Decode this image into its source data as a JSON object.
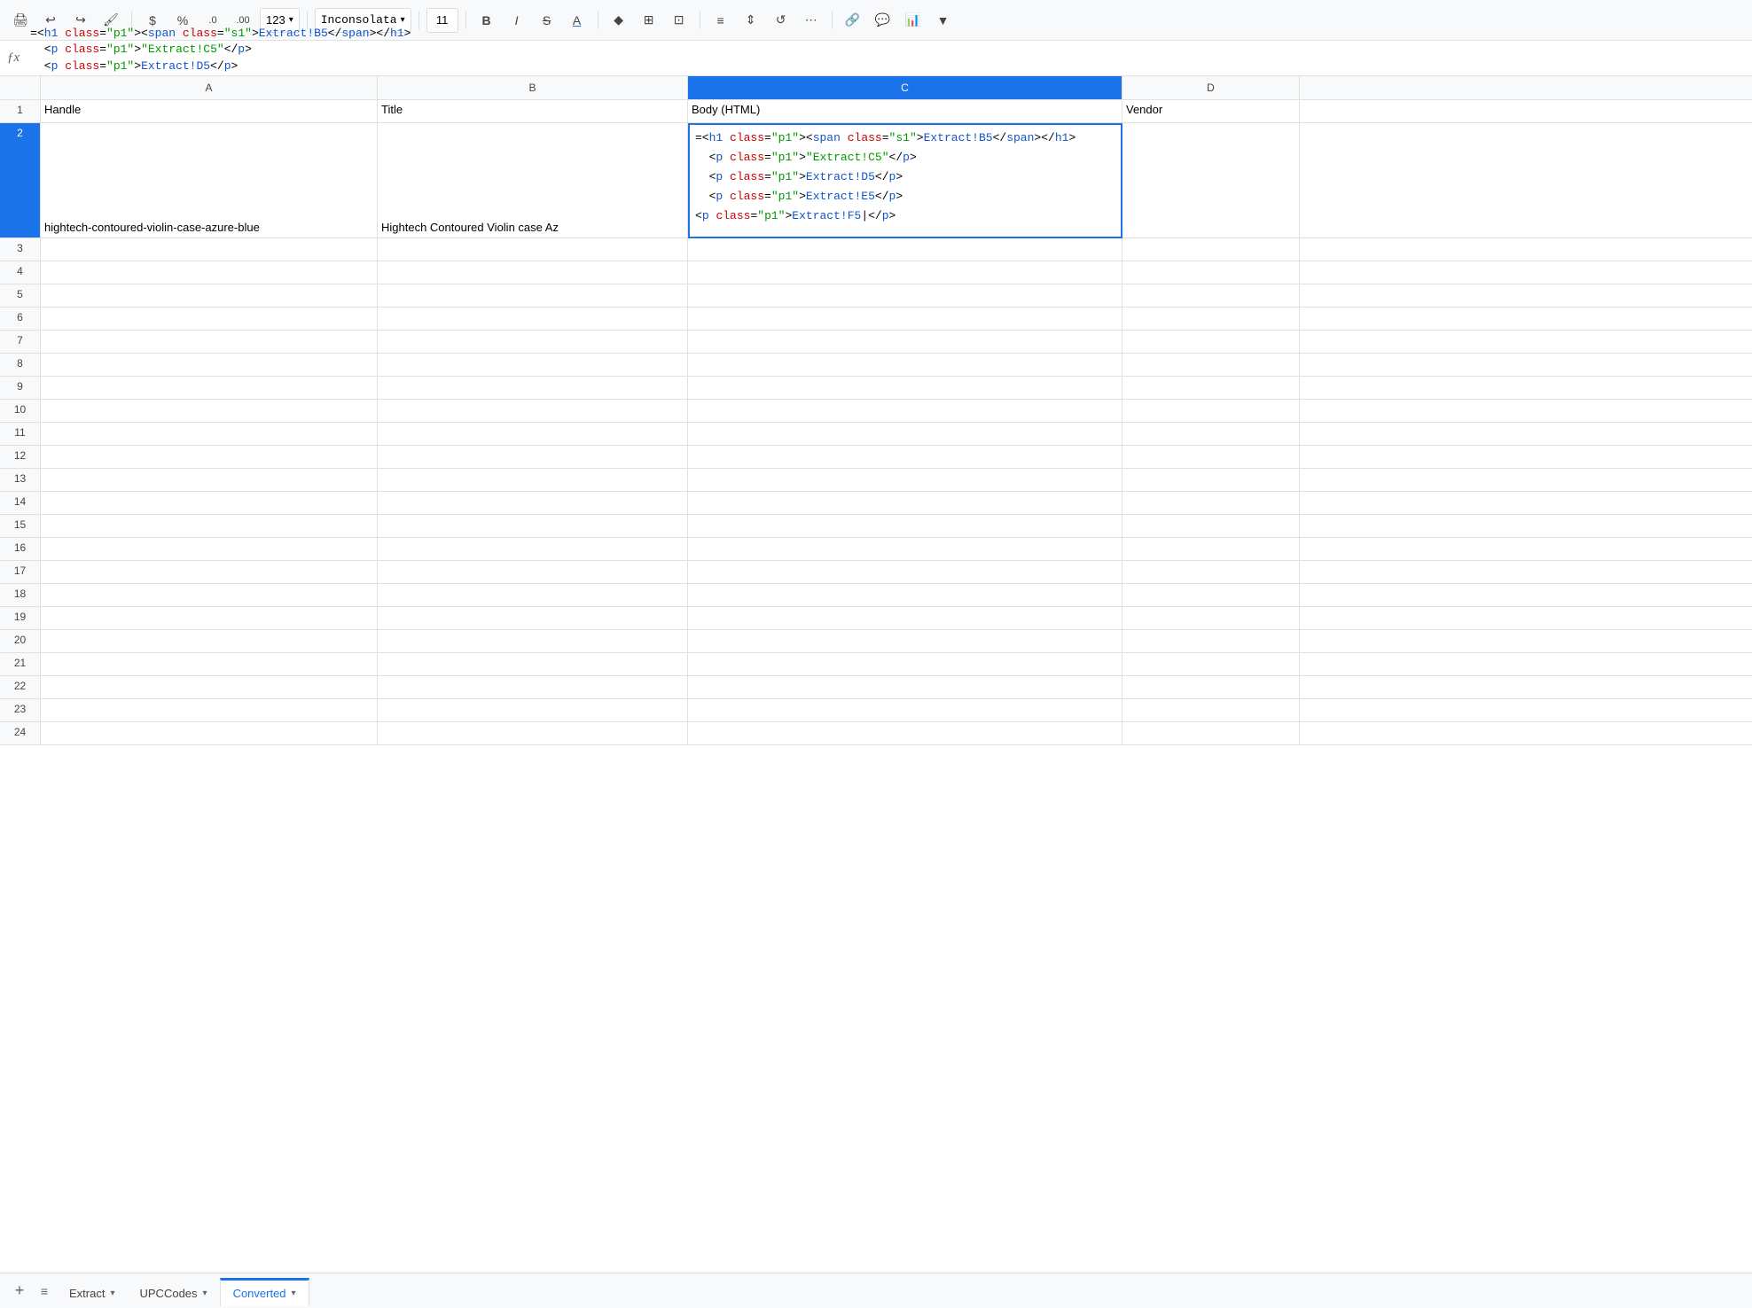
{
  "toolbar": {
    "print_label": "🖨",
    "undo_label": "↩",
    "redo_label": "↪",
    "paint_label": "🖌",
    "currency_label": "$",
    "percent_label": "%",
    "decimal_dec_label": ".0",
    "decimal_inc_label": ".00",
    "more_formats_label": "123",
    "font_name": "Inconsolata",
    "font_size": "11",
    "bold_label": "B",
    "italic_label": "I",
    "strikethrough_label": "S",
    "underline_label": "A",
    "text_color_label": "A",
    "fill_color_label": "◆",
    "borders_label": "⊞",
    "merge_label": "⊡",
    "halign_label": "≡",
    "valign_label": "⇕",
    "rotate_label": "↺",
    "more_label": "⋯",
    "link_label": "🔗",
    "comment_label": "💬",
    "chart_label": "📊",
    "filter_label": "▼"
  },
  "formula_bar": {
    "icon": "ƒx",
    "lines": [
      "=<h1 class=\"p1\"><span class=\"s1\">Extract!B5</span></h1>",
      "  <p class=\"p1\">\"Extract!C5\"</p>",
      "  <p class=\"p1\">Extract!D5</p>",
      "  <p class=\"p1\">Extract!E5</p>"
    ]
  },
  "columns": {
    "headers": [
      "A",
      "B",
      "C",
      "D"
    ],
    "labels": [
      "Handle",
      "Title",
      "Body (HTML)",
      "Vendor"
    ]
  },
  "rows": {
    "count": 24,
    "data": [
      {
        "num": 1,
        "a": "Handle",
        "b": "Title",
        "c": "Body (HTML)",
        "d": "Vendor"
      },
      {
        "num": 2,
        "a": "hightech-contoured-violin-case-azure-blue",
        "b": "Hightech Contoured Violin case Az",
        "c": "FORMULA_CELL",
        "d": ""
      },
      {
        "num": 3,
        "a": "",
        "b": "",
        "c": "",
        "d": ""
      },
      {
        "num": 4,
        "a": "",
        "b": "",
        "c": "",
        "d": ""
      },
      {
        "num": 5,
        "a": "",
        "b": "",
        "c": "",
        "d": ""
      }
    ]
  },
  "cell_overlay": {
    "lines": [
      {
        "type": "mixed",
        "parts": [
          {
            "text": "=<",
            "color": "plain"
          },
          {
            "text": "h1",
            "color": "tag"
          },
          {
            "text": " ",
            "color": "plain"
          },
          {
            "text": "class",
            "color": "attr"
          },
          {
            "text": "=",
            "color": "plain"
          },
          {
            "text": "\"p1\"",
            "color": "val"
          },
          {
            "text": "><",
            "color": "plain"
          },
          {
            "text": "span",
            "color": "tag"
          },
          {
            "text": " ",
            "color": "plain"
          },
          {
            "text": "class",
            "color": "attr"
          },
          {
            "text": "=",
            "color": "plain"
          },
          {
            "text": "\"s1\"",
            "color": "val"
          },
          {
            "text": ">",
            "color": "plain"
          },
          {
            "text": "Extract!B5",
            "color": "ref"
          },
          {
            "text": "</",
            "color": "plain"
          },
          {
            "text": "span",
            "color": "tag"
          },
          {
            "text": "></",
            "color": "plain"
          },
          {
            "text": "h1",
            "color": "tag"
          },
          {
            "text": ">",
            "color": "plain"
          }
        ]
      },
      {
        "type": "mixed",
        "parts": [
          {
            "text": "  <",
            "color": "plain"
          },
          {
            "text": "p",
            "color": "tag"
          },
          {
            "text": " ",
            "color": "plain"
          },
          {
            "text": "class",
            "color": "attr"
          },
          {
            "text": "=",
            "color": "plain"
          },
          {
            "text": "\"p1\"",
            "color": "val"
          },
          {
            "text": ">",
            "color": "plain"
          },
          {
            "text": "\"Extract!C5\"",
            "color": "val"
          },
          {
            "text": "</",
            "color": "plain"
          },
          {
            "text": "p",
            "color": "tag"
          },
          {
            "text": ">",
            "color": "plain"
          }
        ]
      },
      {
        "type": "mixed",
        "parts": [
          {
            "text": "  <",
            "color": "plain"
          },
          {
            "text": "p",
            "color": "tag"
          },
          {
            "text": " ",
            "color": "plain"
          },
          {
            "text": "class",
            "color": "attr"
          },
          {
            "text": "=",
            "color": "plain"
          },
          {
            "text": "\"p1\"",
            "color": "val"
          },
          {
            "text": ">",
            "color": "plain"
          },
          {
            "text": "Extract!D5",
            "color": "ref"
          },
          {
            "text": "</",
            "color": "plain"
          },
          {
            "text": "p",
            "color": "tag"
          },
          {
            "text": ">",
            "color": "plain"
          }
        ]
      },
      {
        "type": "mixed",
        "parts": [
          {
            "text": "  <",
            "color": "plain"
          },
          {
            "text": "p",
            "color": "tag"
          },
          {
            "text": " ",
            "color": "plain"
          },
          {
            "text": "class",
            "color": "attr"
          },
          {
            "text": "=",
            "color": "plain"
          },
          {
            "text": "\"p1\"",
            "color": "val"
          },
          {
            "text": ">",
            "color": "plain"
          },
          {
            "text": "Extract!E5",
            "color": "ref"
          },
          {
            "text": "</",
            "color": "plain"
          },
          {
            "text": "p",
            "color": "tag"
          },
          {
            "text": ">",
            "color": "plain"
          }
        ]
      },
      {
        "type": "mixed",
        "parts": [
          {
            "text": "<",
            "color": "plain"
          },
          {
            "text": "p",
            "color": "tag"
          },
          {
            "text": " ",
            "color": "plain"
          },
          {
            "text": "class",
            "color": "attr"
          },
          {
            "text": "=",
            "color": "plain"
          },
          {
            "text": "\"p1\"",
            "color": "val"
          },
          {
            "text": ">",
            "color": "plain"
          },
          {
            "text": "Extract!F5",
            "color": "ref"
          },
          {
            "text": "|",
            "color": "plain"
          },
          {
            "text": "</",
            "color": "plain"
          },
          {
            "text": "p",
            "color": "tag"
          },
          {
            "text": ">",
            "color": "plain"
          }
        ]
      }
    ]
  },
  "tabs": [
    {
      "label": "Extract",
      "active": false
    },
    {
      "label": "UPCCodes",
      "active": false
    },
    {
      "label": "Converted",
      "active": true
    }
  ]
}
